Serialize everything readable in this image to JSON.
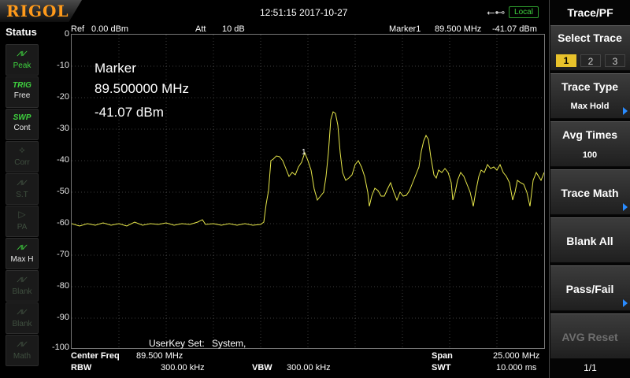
{
  "header": {
    "brand": "RIGOL",
    "datetime": "12:51:15 2017-10-27",
    "usb_icon": "usb-icon",
    "local_label": "Local"
  },
  "status": {
    "title": "Status",
    "buttons": [
      {
        "label": "Peak",
        "icon": "peak-icon",
        "active": true
      },
      {
        "label": "TRIG",
        "sub": "Free",
        "active": true
      },
      {
        "label": "SWP",
        "sub": "Cont",
        "active": true
      },
      {
        "label": "Corr",
        "icon": "corr-icon",
        "active": false
      },
      {
        "label": "S.T",
        "icon": "st-icon",
        "active": false
      },
      {
        "label": "PA",
        "icon": "pa-icon",
        "active": false
      },
      {
        "label": "Max H",
        "icon": "maxhold-icon",
        "active": true
      },
      {
        "label": "Blank",
        "icon": "blank-icon",
        "active": false
      },
      {
        "label": "Blank",
        "icon": "blank-icon",
        "active": false
      },
      {
        "label": "Math",
        "icon": "math-icon",
        "active": false
      }
    ]
  },
  "plot": {
    "ref_label": "Ref",
    "ref_value": "0.00 dBm",
    "att_label": "Att",
    "att_value": "10 dB",
    "marker_label": "Marker1",
    "marker_freq": "89.500 MHz",
    "marker_amp": "-41.07 dBm",
    "marker_box_title": "Marker",
    "marker_box_freq": "89.500000 MHz",
    "marker_box_amp": "-41.07 dBm",
    "marker_number": "1",
    "y_ticks": [
      "0",
      "-10",
      "-20",
      "-30",
      "-40",
      "-50",
      "-60",
      "-70",
      "-80",
      "-90",
      "-100"
    ],
    "userkey_label": "UserKey Set:",
    "userkey_value": "System,",
    "trace_color": "#e8e84a"
  },
  "footer": {
    "center_freq_label": "Center Freq",
    "center_freq_value": "89.500 MHz",
    "span_label": "Span",
    "span_value": "25.000 MHz",
    "rbw_label": "RBW",
    "rbw_value": "300.00 kHz",
    "vbw_label": "VBW",
    "vbw_value": "300.00 kHz",
    "swt_label": "SWT",
    "swt_value": "10.000 ms"
  },
  "menu": {
    "title": "Trace/PF",
    "select_trace_label": "Select Trace",
    "traces": [
      "1",
      "2",
      "3"
    ],
    "selected_trace": "1",
    "trace_type_label": "Trace Type",
    "trace_type_value": "Max Hold",
    "avg_times_label": "Avg Times",
    "avg_times_value": "100",
    "trace_math_label": "Trace Math",
    "blank_all_label": "Blank All",
    "pass_fail_label": "Pass/Fail",
    "avg_reset_label": "AVG Reset",
    "page_indicator": "1/1"
  }
}
